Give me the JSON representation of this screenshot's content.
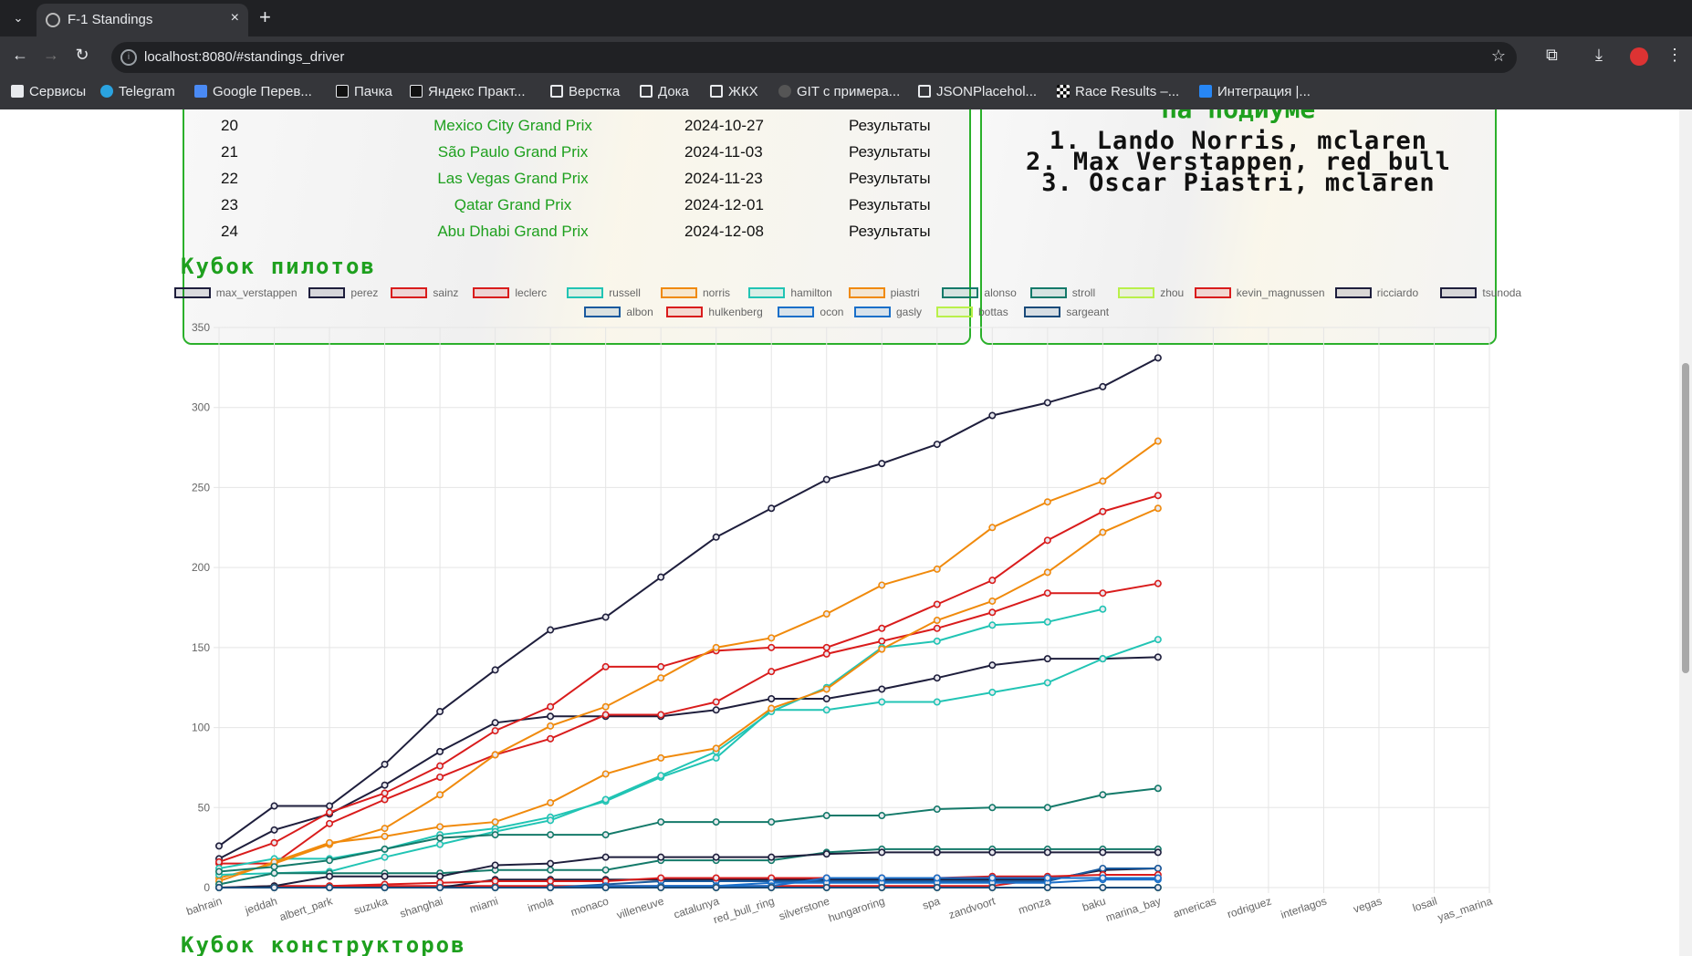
{
  "browser": {
    "tab_title": "F-1 Standings",
    "url": "localhost:8080/#standings_driver",
    "bookmarks": [
      "Сервисы",
      "Telegram",
      "Google Перев...",
      "Пачка",
      "Яндекс Практ...",
      "Верстка",
      "Дока",
      "ЖКХ",
      "GIT с примера...",
      "JSONPlacehol...",
      "Race Results –...",
      "Интеграция |..."
    ]
  },
  "races": [
    {
      "num": "20",
      "name": "Mexico City Grand Prix",
      "date": "2024-10-27",
      "link": "Результаты"
    },
    {
      "num": "21",
      "name": "São Paulo Grand Prix",
      "date": "2024-11-03",
      "link": "Результаты"
    },
    {
      "num": "22",
      "name": "Las Vegas Grand Prix",
      "date": "2024-11-23",
      "link": "Результаты"
    },
    {
      "num": "23",
      "name": "Qatar Grand Prix",
      "date": "2024-12-01",
      "link": "Результаты"
    },
    {
      "num": "24",
      "name": "Abu Dhabi Grand Prix",
      "date": "2024-12-08",
      "link": "Результаты"
    }
  ],
  "podium": {
    "title": "На подиуме",
    "lines": [
      "1. Lando Norris, mclaren",
      "2. Max Verstappen, red_bull",
      "3. Oscar Piastri, mclaren"
    ]
  },
  "sections": {
    "drivers_cup": "Кубок пилотов",
    "constructors_cup": "Кубок конструкторов"
  },
  "chart_data": {
    "type": "line",
    "title": "",
    "xlabel": "",
    "ylabel": "",
    "ylim": [
      0,
      350
    ],
    "yticks": [
      0,
      50,
      100,
      150,
      200,
      250,
      300,
      350
    ],
    "grid": true,
    "legend_position": "top",
    "categories": [
      "bahrain",
      "jeddah",
      "albert_park",
      "suzuka",
      "shanghai",
      "miami",
      "imola",
      "monaco",
      "villeneuve",
      "catalunya",
      "red_bull_ring",
      "silverstone",
      "hungaroring",
      "spa",
      "zandvoort",
      "monza",
      "baku",
      "marina_bay",
      "americas",
      "rodriguez",
      "interlagos",
      "vegas",
      "losail",
      "yas_marina"
    ],
    "series": [
      {
        "name": "max_verstappen",
        "color": "#1e1e3c",
        "values": [
          26,
          51,
          51,
          77,
          110,
          136,
          161,
          169,
          194,
          219,
          237,
          255,
          265,
          277,
          295,
          303,
          313,
          331
        ]
      },
      {
        "name": "perez",
        "color": "#1e1e3c",
        "values": [
          18,
          36,
          46,
          64,
          85,
          103,
          107,
          107,
          107,
          111,
          118,
          118,
          124,
          131,
          139,
          143,
          143,
          144
        ]
      },
      {
        "name": "sainz",
        "color": "#d91c1c",
        "values": [
          15,
          15,
          40,
          55,
          69,
          83,
          93,
          108,
          108,
          116,
          135,
          146,
          154,
          162,
          172,
          184,
          184,
          190
        ]
      },
      {
        "name": "leclerc",
        "color": "#d91c1c",
        "values": [
          16,
          28,
          47,
          59,
          76,
          98,
          113,
          138,
          138,
          148,
          150,
          150,
          162,
          177,
          192,
          217,
          235,
          245
        ]
      },
      {
        "name": "russell",
        "color": "#21c4b4",
        "values": [
          12,
          18,
          18,
          24,
          33,
          37,
          44,
          54,
          69,
          81,
          111,
          111,
          116,
          116,
          122,
          128,
          143,
          155
        ]
      },
      {
        "name": "norris",
        "color": "#f08a0c",
        "values": [
          6,
          15,
          27,
          37,
          58,
          83,
          101,
          113,
          131,
          150,
          156,
          171,
          189,
          199,
          225,
          241,
          254,
          279
        ]
      },
      {
        "name": "hamilton",
        "color": "#21c4b4",
        "values": [
          8,
          9,
          10,
          19,
          27,
          35,
          42,
          55,
          70,
          85,
          110,
          125,
          150,
          154,
          164,
          166,
          174
        ]
      },
      {
        "name": "piastri",
        "color": "#f08a0c",
        "values": [
          4,
          16,
          28,
          32,
          38,
          41,
          53,
          71,
          81,
          87,
          112,
          124,
          149,
          167,
          179,
          197,
          222,
          237
        ]
      },
      {
        "name": "alonso",
        "color": "#147a6a",
        "values": [
          10,
          13,
          17,
          24,
          31,
          33,
          33,
          33,
          41,
          41,
          41,
          45,
          45,
          49,
          50,
          50,
          58,
          62
        ]
      },
      {
        "name": "stroll",
        "color": "#147a6a",
        "values": [
          2,
          9,
          9,
          9,
          9,
          11,
          11,
          11,
          17,
          17,
          17,
          22,
          24,
          24,
          24,
          24,
          24,
          24
        ]
      },
      {
        "name": "zhou",
        "color": "#b9f04a",
        "values": [
          0,
          0,
          0,
          0,
          0,
          0,
          0,
          0,
          0,
          0,
          0,
          0,
          0,
          0,
          0,
          0,
          0,
          0
        ]
      },
      {
        "name": "kevin_magnussen",
        "color": "#d91c1c",
        "values": [
          0,
          1,
          1,
          1,
          1,
          1,
          1,
          1,
          1,
          1,
          1,
          1,
          1,
          1,
          1,
          6,
          6,
          6
        ]
      },
      {
        "name": "ricciardo",
        "color": "#1e1e3c",
        "values": [
          0,
          0,
          0,
          0,
          0,
          5,
          5,
          5,
          5,
          5,
          5,
          5,
          5,
          5,
          5,
          5,
          11,
          12
        ]
      },
      {
        "name": "tsunoda",
        "color": "#1e1e3c",
        "values": [
          0,
          1,
          7,
          7,
          7,
          14,
          15,
          19,
          19,
          19,
          19,
          21,
          22,
          22,
          22,
          22,
          22,
          22
        ]
      },
      {
        "name": "albon",
        "color": "#1a5a9e",
        "values": [
          0,
          0,
          0,
          0,
          0,
          0,
          0,
          2,
          4,
          4,
          4,
          4,
          4,
          4,
          4,
          4,
          12,
          12
        ]
      },
      {
        "name": "hulkenberg",
        "color": "#d91c1c",
        "values": [
          0,
          0,
          1,
          2,
          3,
          4,
          4,
          4,
          6,
          6,
          6,
          6,
          6,
          6,
          7,
          7,
          8,
          8
        ]
      },
      {
        "name": "ocon",
        "color": "#1a6fc9",
        "values": [
          0,
          0,
          0,
          0,
          0,
          0,
          0,
          1,
          1,
          1,
          3,
          3,
          3,
          3,
          3,
          3,
          5,
          5
        ]
      },
      {
        "name": "gasly",
        "color": "#1a6fc9",
        "values": [
          0,
          0,
          0,
          0,
          0,
          0,
          0,
          0,
          1,
          1,
          1,
          6,
          6,
          6,
          6,
          6,
          6,
          6
        ]
      },
      {
        "name": "bottas",
        "color": "#b9f04a",
        "values": [
          0,
          0,
          0,
          0,
          0,
          0,
          0,
          0,
          0,
          0,
          0,
          0,
          0,
          0,
          0,
          0,
          0,
          0
        ]
      },
      {
        "name": "sargeant",
        "color": "#1a4a7a",
        "values": [
          0,
          0,
          0,
          0,
          0,
          0,
          0,
          0,
          0,
          0,
          0,
          0,
          0,
          0,
          0,
          0,
          0,
          0
        ]
      }
    ]
  }
}
